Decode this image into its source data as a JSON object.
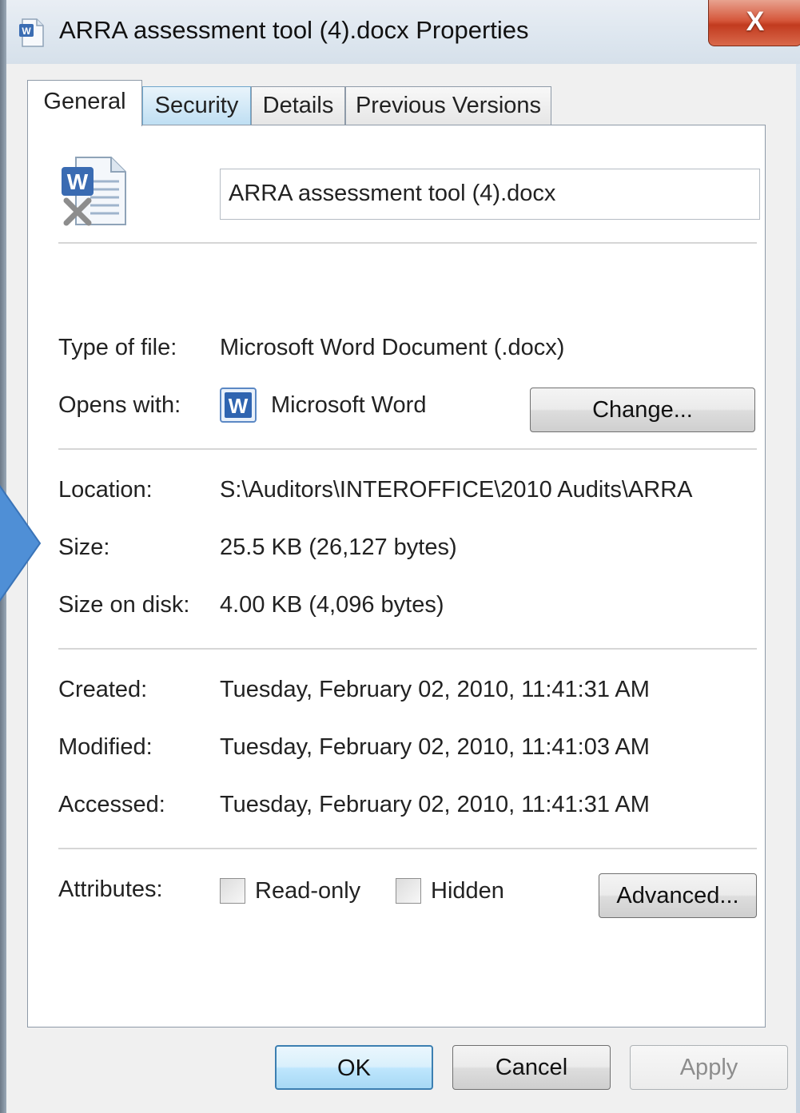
{
  "window": {
    "title": "ARRA assessment tool (4).docx Properties",
    "close_label": "X"
  },
  "tabs": [
    {
      "label": "General",
      "active": true
    },
    {
      "label": "Security",
      "active": false
    },
    {
      "label": "Details",
      "active": false
    },
    {
      "label": "Previous Versions",
      "active": false
    }
  ],
  "general": {
    "file_name": "ARRA assessment tool (4).docx",
    "type_label": "Type of file:",
    "type_value": "Microsoft Word Document (.docx)",
    "opens_label": "Opens with:",
    "opens_value": "Microsoft Word",
    "change_button": "Change...",
    "location_label": "Location:",
    "location_value": "S:\\Auditors\\INTEROFFICE\\2010 Audits\\ARRA",
    "size_label": "Size:",
    "size_value": "25.5 KB (26,127 bytes)",
    "size_on_disk_label": "Size on disk:",
    "size_on_disk_value": "4.00 KB (4,096 bytes)",
    "created_label": "Created:",
    "created_value": "Tuesday, February 02, 2010, 11:41:31 AM",
    "modified_label": "Modified:",
    "modified_value": "Tuesday, February 02, 2010, 11:41:03 AM",
    "accessed_label": "Accessed:",
    "accessed_value": "Tuesday, February 02, 2010, 11:41:31 AM",
    "attributes_label": "Attributes:",
    "readonly_label": "Read-only",
    "readonly_checked": false,
    "hidden_label": "Hidden",
    "hidden_checked": false,
    "advanced_button": "Advanced..."
  },
  "footer": {
    "ok": "OK",
    "cancel": "Cancel",
    "apply": "Apply"
  },
  "colors": {
    "close_button": "#d5573b",
    "ok_border": "#3c7fb1",
    "arrow_fill": "#4f8fd6"
  }
}
